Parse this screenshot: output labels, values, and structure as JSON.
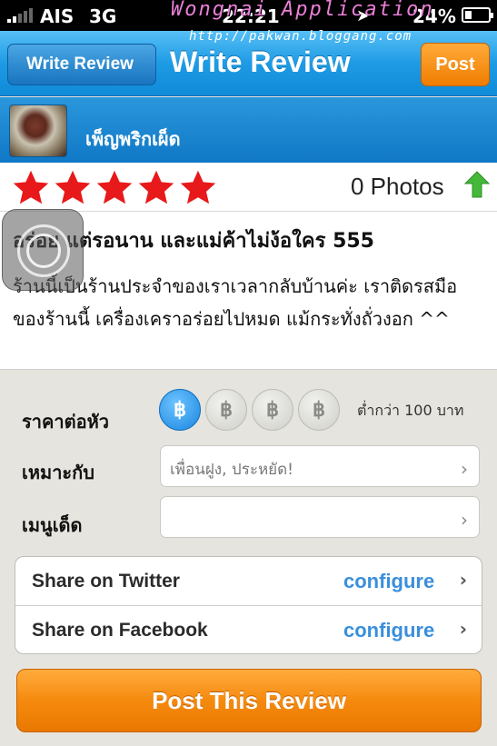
{
  "status_bar": {
    "carrier": "AIS",
    "network": "3G",
    "time": "22:21",
    "battery_percent": "24%"
  },
  "watermark": {
    "title": "Wongnai Application",
    "url": "http://pakwan.bloggang.com"
  },
  "nav": {
    "back_label": "Write Review",
    "title": "Write Review",
    "post_label": "Post"
  },
  "restaurant": {
    "name": "เพ็ญพริกเผ็ด"
  },
  "rating": {
    "stars": 5,
    "max_stars": 5,
    "star_color": "#e8191a",
    "photos_label": "0 Photos",
    "upload_icon": "upload-arrow-icon"
  },
  "review": {
    "title": "อร่อย แต่รอนาน และแม่ค้าไม่ง้อใคร 555",
    "body": "ร้านนี้เป็นร้านประจำของเราเวลากลับบ้านค่ะ เราติดรสมือของร้านนี้ เครื่องเคราอร่อยไปหมด แม้กระทั่งถั่วงอก ^^"
  },
  "form": {
    "price_label": "ราคาต่อหัว",
    "price_symbol": "฿",
    "price_level": 1,
    "price_levels_total": 4,
    "price_note": "ต่ำกว่า 100 บาท",
    "suitable_label": "เหมาะกับ",
    "suitable_placeholder": "เพื่อนฝูง, ประหยัด!",
    "signature_label": "เมนูเด็ด",
    "signature_placeholder": ""
  },
  "share": {
    "twitter_label": "Share on Twitter",
    "twitter_action": "configure",
    "facebook_label": "Share on Facebook",
    "facebook_action": "configure"
  },
  "submit_label": "Post This Review",
  "colors": {
    "nav_blue": "#1e9be5",
    "accent_orange": "#f58a0e",
    "link_blue": "#3a8fdc"
  }
}
